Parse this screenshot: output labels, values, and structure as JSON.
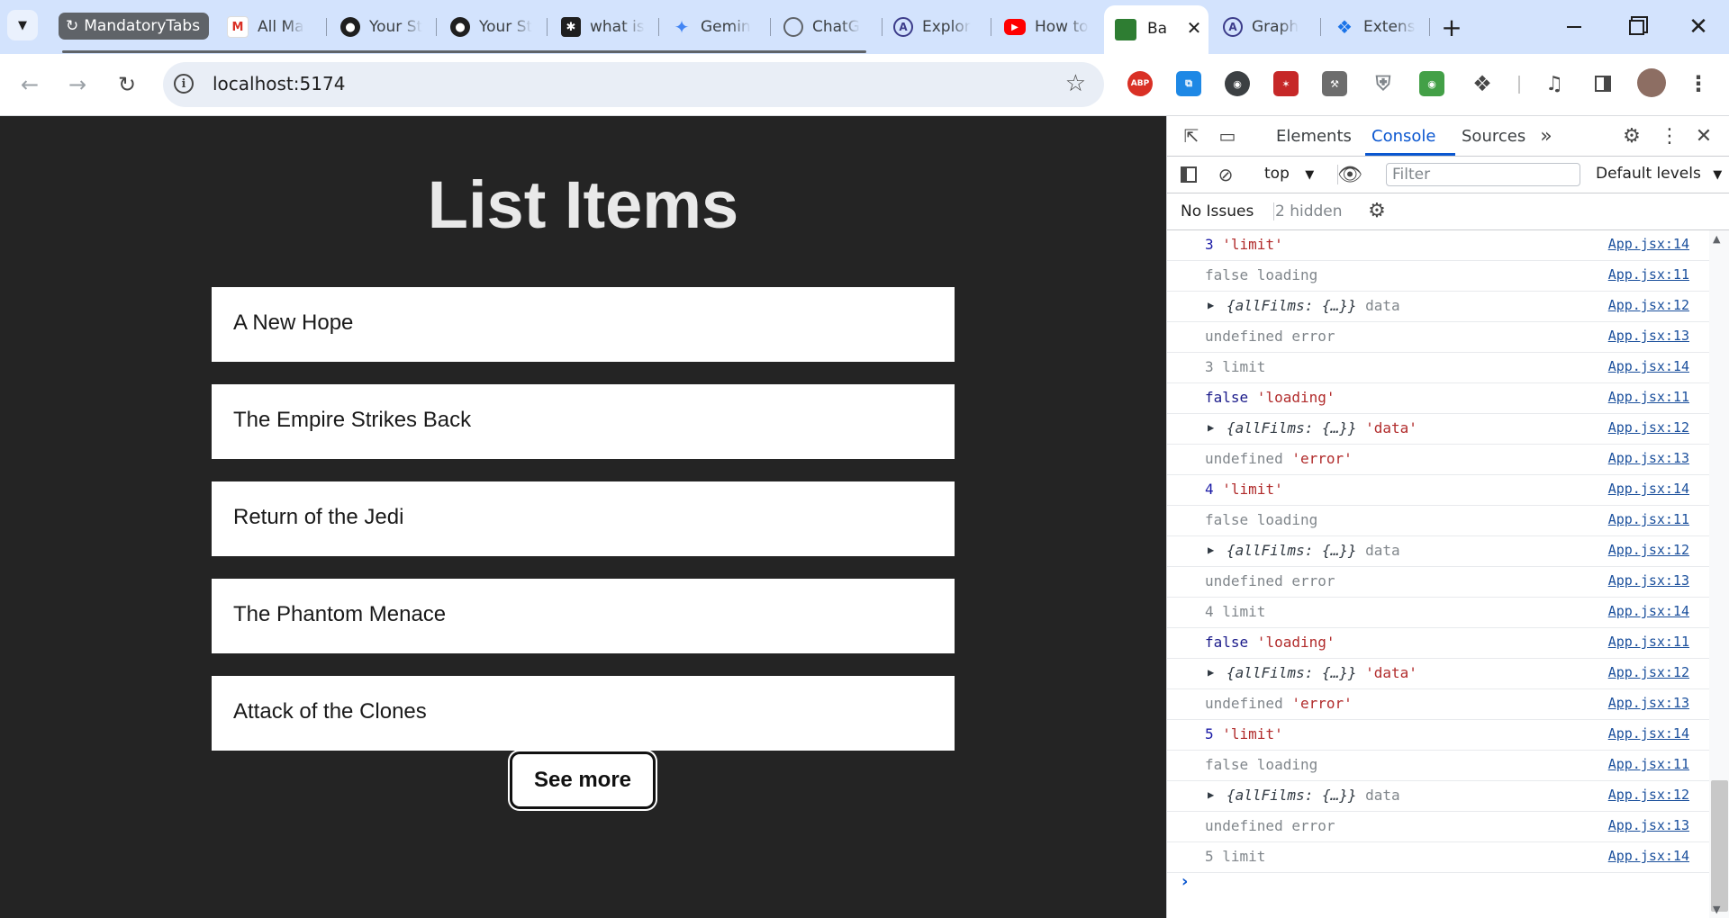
{
  "browser": {
    "tab_group_name": "MandatoryTabs",
    "tabs": [
      {
        "title": "All Ma",
        "icon": "gmail-icon"
      },
      {
        "title": "Your St",
        "icon": "github-icon"
      },
      {
        "title": "Your St",
        "icon": "github-icon"
      },
      {
        "title": "what is",
        "icon": "perplexity-icon"
      },
      {
        "title": "Gemin",
        "icon": "gemini-icon"
      },
      {
        "title": "ChatG",
        "icon": "chatgpt-icon"
      },
      {
        "title": "Explor",
        "icon": "apollo-icon"
      },
      {
        "title": "How to",
        "icon": "youtube-icon"
      },
      {
        "title": "Ba",
        "icon": "app-icon",
        "active": true
      },
      {
        "title": "Graph",
        "icon": "apollo-icon"
      },
      {
        "title": "Extens",
        "icon": "puzzle-icon"
      }
    ],
    "url": "localhost:5174"
  },
  "page": {
    "title": "List Items",
    "items": [
      "A New Hope",
      "The Empire Strikes Back",
      "Return of the Jedi",
      "The Phantom Menace",
      "Attack of the Clones"
    ],
    "see_more_label": "See more"
  },
  "devtools": {
    "tabs": [
      "Elements",
      "Console",
      "Sources"
    ],
    "active_tab": "Console",
    "context": "top",
    "filter_placeholder": "Filter",
    "levels": "Default levels",
    "issues": "No Issues",
    "hidden": "2 hidden",
    "logs": [
      {
        "parts": [
          [
            "3",
            "num"
          ],
          [
            " 'limit'",
            "str"
          ]
        ],
        "src": "App.jsx:14"
      },
      {
        "parts": [
          [
            "false loading",
            "gray"
          ]
        ],
        "src": "App.jsx:11"
      },
      {
        "parts": [
          [
            "{allFilms: {…}}",
            "obj"
          ],
          [
            " data",
            "gray"
          ]
        ],
        "src": "App.jsx:12",
        "expandable": true
      },
      {
        "parts": [
          [
            "undefined error",
            "gray"
          ]
        ],
        "src": "App.jsx:13"
      },
      {
        "parts": [
          [
            "3 limit",
            "gray"
          ]
        ],
        "src": "App.jsx:14"
      },
      {
        "parts": [
          [
            "false",
            "bool"
          ],
          [
            " 'loading'",
            "str"
          ]
        ],
        "src": "App.jsx:11"
      },
      {
        "parts": [
          [
            "{allFilms: {…}}",
            "obj"
          ],
          [
            " 'data'",
            "str"
          ]
        ],
        "src": "App.jsx:12",
        "expandable": true
      },
      {
        "parts": [
          [
            "undefined",
            "gray"
          ],
          [
            " 'error'",
            "str"
          ]
        ],
        "src": "App.jsx:13"
      },
      {
        "parts": [
          [
            "4",
            "num"
          ],
          [
            " 'limit'",
            "str"
          ]
        ],
        "src": "App.jsx:14"
      },
      {
        "parts": [
          [
            "false loading",
            "gray"
          ]
        ],
        "src": "App.jsx:11"
      },
      {
        "parts": [
          [
            "{allFilms: {…}}",
            "obj"
          ],
          [
            " data",
            "gray"
          ]
        ],
        "src": "App.jsx:12",
        "expandable": true
      },
      {
        "parts": [
          [
            "undefined error",
            "gray"
          ]
        ],
        "src": "App.jsx:13"
      },
      {
        "parts": [
          [
            "4 limit",
            "gray"
          ]
        ],
        "src": "App.jsx:14"
      },
      {
        "parts": [
          [
            "false",
            "bool"
          ],
          [
            " 'loading'",
            "str"
          ]
        ],
        "src": "App.jsx:11"
      },
      {
        "parts": [
          [
            "{allFilms: {…}}",
            "obj"
          ],
          [
            " 'data'",
            "str"
          ]
        ],
        "src": "App.jsx:12",
        "expandable": true
      },
      {
        "parts": [
          [
            "undefined",
            "gray"
          ],
          [
            " 'error'",
            "str"
          ]
        ],
        "src": "App.jsx:13"
      },
      {
        "parts": [
          [
            "5",
            "num"
          ],
          [
            " 'limit'",
            "str"
          ]
        ],
        "src": "App.jsx:14"
      },
      {
        "parts": [
          [
            "false loading",
            "gray"
          ]
        ],
        "src": "App.jsx:11"
      },
      {
        "parts": [
          [
            "{allFilms: {…}}",
            "obj"
          ],
          [
            " data",
            "gray"
          ]
        ],
        "src": "App.jsx:12",
        "expandable": true
      },
      {
        "parts": [
          [
            "undefined error",
            "gray"
          ]
        ],
        "src": "App.jsx:13"
      },
      {
        "parts": [
          [
            "5 limit",
            "gray"
          ]
        ],
        "src": "App.jsx:14"
      }
    ]
  },
  "colors": {
    "tabstrip": "#d3e3fd",
    "page_bg": "#242424",
    "accent": "#0b57d0"
  }
}
